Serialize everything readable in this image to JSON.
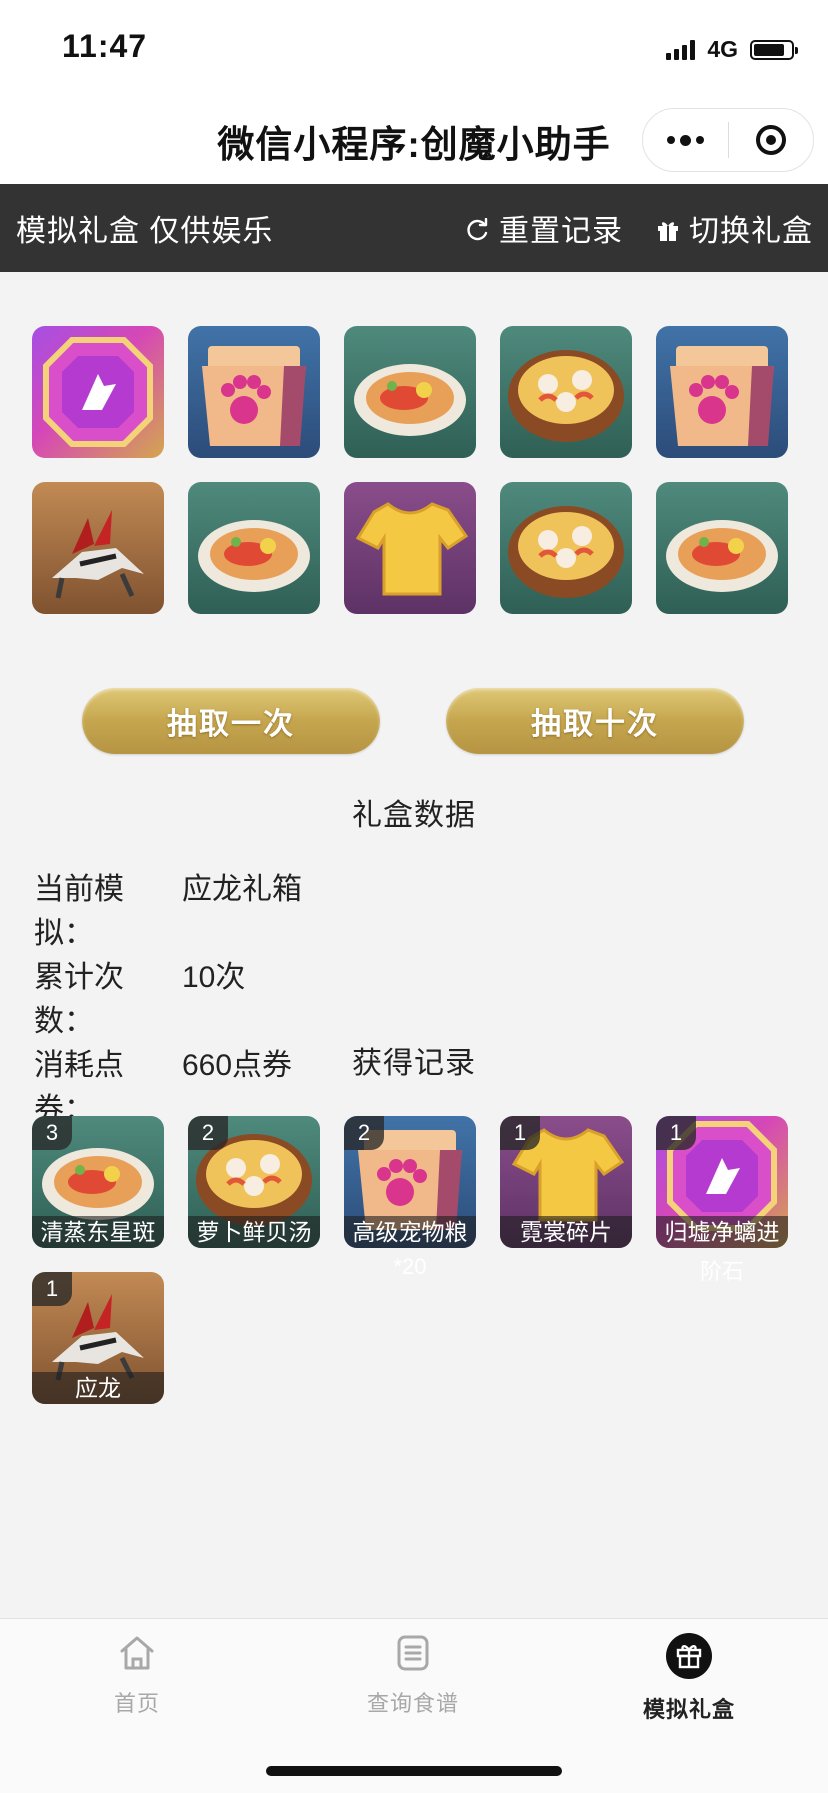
{
  "status": {
    "time": "11:47",
    "network": "4G"
  },
  "nav": {
    "title": "微信小程序:创魔小助手"
  },
  "toolbar": {
    "title": "模拟礼盒 仅供娱乐",
    "reset_label": "重置记录",
    "switch_label": "切换礼盒"
  },
  "results": [
    {
      "icon": "violet-gem-icon"
    },
    {
      "icon": "pet-food-bag-icon"
    },
    {
      "icon": "steamed-fish-dish-icon"
    },
    {
      "icon": "radish-clam-soup-icon"
    },
    {
      "icon": "pet-food-bag-icon"
    },
    {
      "icon": "dragon-mount-icon"
    },
    {
      "icon": "steamed-fish-dish-icon"
    },
    {
      "icon": "golden-shirt-icon"
    },
    {
      "icon": "radish-clam-soup-icon"
    },
    {
      "icon": "steamed-fish-dish-icon"
    }
  ],
  "buttons": {
    "draw_once": "抽取一次",
    "draw_ten": "抽取十次"
  },
  "stats": {
    "section_title": "礼盒数据",
    "current_label": "当前模拟：",
    "current_value": "应龙礼箱",
    "count_label": "累计次数：",
    "count_value": "10次",
    "cost_label": "消耗点券：",
    "cost_value": "660点券"
  },
  "records": {
    "section_title": "获得记录",
    "items": [
      {
        "count": "3",
        "name": "清蒸东星斑",
        "icon": "steamed-fish-dish-icon"
      },
      {
        "count": "2",
        "name": "萝卜鲜贝汤",
        "icon": "radish-clam-soup-icon"
      },
      {
        "count": "2",
        "name": "高级宠物粮",
        "extra": "*20",
        "icon": "pet-food-bag-icon"
      },
      {
        "count": "1",
        "name": "霓裳碎片",
        "icon": "golden-shirt-icon"
      },
      {
        "count": "1",
        "name": "归墟净螭进",
        "extra": "阶石",
        "icon": "violet-gem-icon"
      },
      {
        "count": "1",
        "name": "应龙",
        "icon": "dragon-mount-icon"
      }
    ]
  },
  "tabbar": {
    "home": "首页",
    "recipes": "查询食谱",
    "gift": "模拟礼盒"
  },
  "colors": {
    "toolbar_bg": "#333333",
    "gold_button": "#c5a64e",
    "page_bg": "#f3f3f3"
  }
}
